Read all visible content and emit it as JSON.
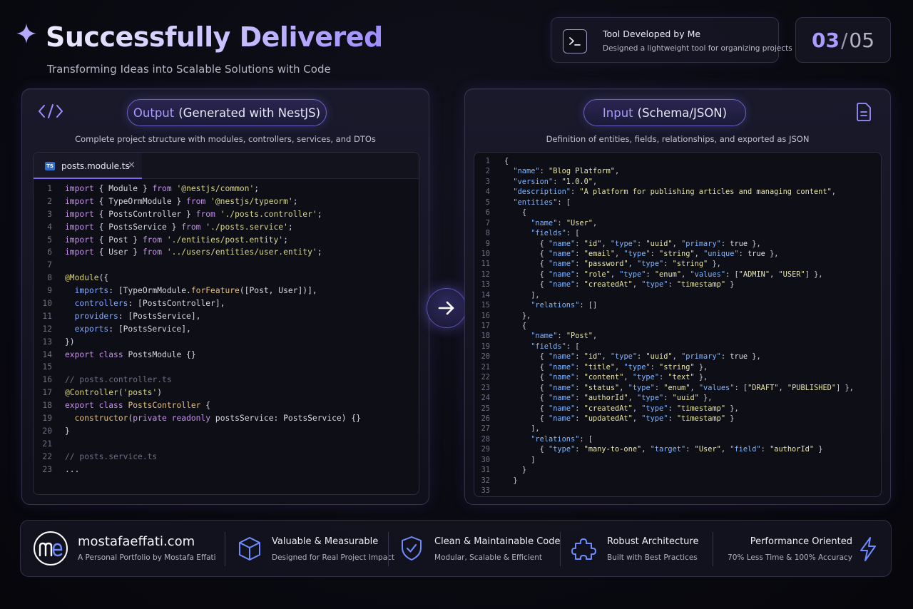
{
  "header": {
    "title": "Successfully Delivered",
    "subtitle": "Transforming Ideas into Scalable Solutions with Code"
  },
  "tool_card": {
    "title": "Tool Developed by Me",
    "description": "Designed a lightweight tool for organizing projects"
  },
  "counter": {
    "current": "03",
    "separator": "/",
    "total": "05"
  },
  "output_panel": {
    "pill_highlight": "Output",
    "pill_rest": "(Generated with NestJS)",
    "description": "Complete project structure with modules, controllers, services, and DTOs",
    "tab_label": "posts.module.ts",
    "file_badge": "TS",
    "close_glyph": "×",
    "code_lines": [
      [
        [
          "kw",
          "import"
        ],
        [
          "pl",
          " { Module } "
        ],
        [
          "kw",
          "from"
        ],
        [
          "pl",
          " "
        ],
        [
          "str",
          "'@nestjs/common'"
        ],
        [
          "pl",
          ";"
        ]
      ],
      [
        [
          "kw",
          "import"
        ],
        [
          "pl",
          " { TypeOrmModule } "
        ],
        [
          "kw",
          "from"
        ],
        [
          "pl",
          " "
        ],
        [
          "str",
          "'@nestjs/typeorm'"
        ],
        [
          "pl",
          ";"
        ]
      ],
      [
        [
          "kw",
          "import"
        ],
        [
          "pl",
          " { PostsController } "
        ],
        [
          "kw",
          "from"
        ],
        [
          "pl",
          " "
        ],
        [
          "str",
          "'./posts.controller'"
        ],
        [
          "pl",
          ";"
        ]
      ],
      [
        [
          "kw",
          "import"
        ],
        [
          "pl",
          " { PostsService } "
        ],
        [
          "kw",
          "from"
        ],
        [
          "pl",
          " "
        ],
        [
          "str",
          "'./posts.service'"
        ],
        [
          "pl",
          ";"
        ]
      ],
      [
        [
          "kw",
          "import"
        ],
        [
          "pl",
          " { Post } "
        ],
        [
          "kw",
          "from"
        ],
        [
          "pl",
          " "
        ],
        [
          "str",
          "'./entities/post.entity'"
        ],
        [
          "pl",
          ";"
        ]
      ],
      [
        [
          "kw",
          "import"
        ],
        [
          "pl",
          " { User } "
        ],
        [
          "kw",
          "from"
        ],
        [
          "pl",
          " "
        ],
        [
          "str",
          "'../users/entities/user.entity'"
        ],
        [
          "pl",
          ";"
        ]
      ],
      [],
      [
        [
          "dec",
          "@Module"
        ],
        [
          "pl",
          "({"
        ]
      ],
      [
        [
          "pl",
          "  "
        ],
        [
          "prop",
          "imports"
        ],
        [
          "pl",
          ": [TypeOrmModule."
        ],
        [
          "fn",
          "forFeature"
        ],
        [
          "pl",
          "([Post, User])],"
        ]
      ],
      [
        [
          "pl",
          "  "
        ],
        [
          "prop",
          "controllers"
        ],
        [
          "pl",
          ": [PostsController],"
        ]
      ],
      [
        [
          "pl",
          "  "
        ],
        [
          "prop",
          "providers"
        ],
        [
          "pl",
          ": [PostsService],"
        ]
      ],
      [
        [
          "pl",
          "  "
        ],
        [
          "prop",
          "exports"
        ],
        [
          "pl",
          ": [PostsService],"
        ]
      ],
      [
        [
          "pl",
          "})"
        ]
      ],
      [
        [
          "kw",
          "export"
        ],
        [
          "pl",
          " "
        ],
        [
          "kw",
          "class"
        ],
        [
          "pl",
          " PostsModule {}"
        ]
      ],
      [],
      [
        [
          "cmt",
          "// posts.controller.ts"
        ]
      ],
      [
        [
          "dec",
          "@Controller"
        ],
        [
          "pl",
          "("
        ],
        [
          "str",
          "'posts'"
        ],
        [
          "pl",
          ")"
        ]
      ],
      [
        [
          "kw",
          "export"
        ],
        [
          "pl",
          " "
        ],
        [
          "kw",
          "class"
        ],
        [
          "pl",
          " "
        ],
        [
          "fn",
          "PostsController"
        ],
        [
          "pl",
          " {"
        ]
      ],
      [
        [
          "pl",
          "  "
        ],
        [
          "fn",
          "constructor"
        ],
        [
          "pl",
          "("
        ],
        [
          "kw",
          "private"
        ],
        [
          "pl",
          " "
        ],
        [
          "kw",
          "readonly"
        ],
        [
          "pl",
          " postsService: PostsService) {}"
        ]
      ],
      [
        [
          "pl",
          "}"
        ]
      ],
      [],
      [
        [
          "cmt",
          "// posts.service.ts"
        ]
      ],
      [
        [
          "pl",
          "..."
        ]
      ]
    ]
  },
  "input_panel": {
    "pill_highlight": "Input",
    "pill_rest": "(Schema/JSON)",
    "description": "Definition of entities, fields, relationships, and exported as JSON",
    "code_lines": [
      [
        [
          "punc",
          "{"
        ]
      ],
      [
        [
          "pl",
          "  "
        ],
        [
          "key",
          "\"name\""
        ],
        [
          "punc",
          ": "
        ],
        [
          "jstr",
          "\"Blog Platform\""
        ],
        [
          "punc",
          ","
        ]
      ],
      [
        [
          "pl",
          "  "
        ],
        [
          "key",
          "\"version\""
        ],
        [
          "punc",
          ": "
        ],
        [
          "jstr",
          "\"1.0.0\""
        ],
        [
          "punc",
          ","
        ]
      ],
      [
        [
          "pl",
          "  "
        ],
        [
          "key",
          "\"description\""
        ],
        [
          "punc",
          ": "
        ],
        [
          "jstr",
          "\"A platform for publishing articles and managing content\""
        ],
        [
          "punc",
          ","
        ]
      ],
      [
        [
          "pl",
          "  "
        ],
        [
          "key",
          "\"entities\""
        ],
        [
          "punc",
          ": ["
        ]
      ],
      [
        [
          "pl",
          "    "
        ],
        [
          "punc",
          "{"
        ]
      ],
      [
        [
          "pl",
          "      "
        ],
        [
          "key",
          "\"name\""
        ],
        [
          "punc",
          ": "
        ],
        [
          "jstr",
          "\"User\""
        ],
        [
          "punc",
          ","
        ]
      ],
      [
        [
          "pl",
          "      "
        ],
        [
          "key",
          "\"fields\""
        ],
        [
          "punc",
          ": ["
        ]
      ],
      [
        [
          "pl",
          "        "
        ],
        [
          "punc",
          "{ "
        ],
        [
          "key",
          "\"name\""
        ],
        [
          "punc",
          ": "
        ],
        [
          "jstr",
          "\"id\""
        ],
        [
          "punc",
          ", "
        ],
        [
          "key",
          "\"type\""
        ],
        [
          "punc",
          ": "
        ],
        [
          "jstr",
          "\"uuid\""
        ],
        [
          "punc",
          ", "
        ],
        [
          "key",
          "\"primary\""
        ],
        [
          "punc",
          ": "
        ],
        [
          "jkw",
          "true"
        ],
        [
          "punc",
          " },"
        ]
      ],
      [
        [
          "pl",
          "        "
        ],
        [
          "punc",
          "{ "
        ],
        [
          "key",
          "\"name\""
        ],
        [
          "punc",
          ": "
        ],
        [
          "jstr",
          "\"email\""
        ],
        [
          "punc",
          ", "
        ],
        [
          "key",
          "\"type\""
        ],
        [
          "punc",
          ": "
        ],
        [
          "jstr",
          "\"string\""
        ],
        [
          "punc",
          ", "
        ],
        [
          "key",
          "\"unique\""
        ],
        [
          "punc",
          ": "
        ],
        [
          "jkw",
          "true"
        ],
        [
          "punc",
          " },"
        ]
      ],
      [
        [
          "pl",
          "        "
        ],
        [
          "punc",
          "{ "
        ],
        [
          "key",
          "\"name\""
        ],
        [
          "punc",
          ": "
        ],
        [
          "jstr",
          "\"password\""
        ],
        [
          "punc",
          ", "
        ],
        [
          "key",
          "\"type\""
        ],
        [
          "punc",
          ": "
        ],
        [
          "jstr",
          "\"string\""
        ],
        [
          "punc",
          " },"
        ]
      ],
      [
        [
          "pl",
          "        "
        ],
        [
          "punc",
          "{ "
        ],
        [
          "key",
          "\"name\""
        ],
        [
          "punc",
          ": "
        ],
        [
          "jstr",
          "\"role\""
        ],
        [
          "punc",
          ", "
        ],
        [
          "key",
          "\"type\""
        ],
        [
          "punc",
          ": "
        ],
        [
          "jstr",
          "\"enum\""
        ],
        [
          "punc",
          ", "
        ],
        [
          "key",
          "\"values\""
        ],
        [
          "punc",
          ": ["
        ],
        [
          "jstr",
          "\"ADMIN\""
        ],
        [
          "punc",
          ", "
        ],
        [
          "jstr",
          "\"USER\""
        ],
        [
          "punc",
          "] },"
        ]
      ],
      [
        [
          "pl",
          "        "
        ],
        [
          "punc",
          "{ "
        ],
        [
          "key",
          "\"name\""
        ],
        [
          "punc",
          ": "
        ],
        [
          "jstr",
          "\"createdAt\""
        ],
        [
          "punc",
          ", "
        ],
        [
          "key",
          "\"type\""
        ],
        [
          "punc",
          ": "
        ],
        [
          "jstr",
          "\"timestamp\""
        ],
        [
          "punc",
          " }"
        ]
      ],
      [
        [
          "pl",
          "      "
        ],
        [
          "punc",
          "],"
        ]
      ],
      [
        [
          "pl",
          "      "
        ],
        [
          "key",
          "\"relations\""
        ],
        [
          "punc",
          ": []"
        ]
      ],
      [
        [
          "pl",
          "    "
        ],
        [
          "punc",
          "},"
        ]
      ],
      [
        [
          "pl",
          "    "
        ],
        [
          "punc",
          "{"
        ]
      ],
      [
        [
          "pl",
          "      "
        ],
        [
          "key",
          "\"name\""
        ],
        [
          "punc",
          ": "
        ],
        [
          "jstr",
          "\"Post\""
        ],
        [
          "punc",
          ","
        ]
      ],
      [
        [
          "pl",
          "      "
        ],
        [
          "key",
          "\"fields\""
        ],
        [
          "punc",
          ": ["
        ]
      ],
      [
        [
          "pl",
          "        "
        ],
        [
          "punc",
          "{ "
        ],
        [
          "key",
          "\"name\""
        ],
        [
          "punc",
          ": "
        ],
        [
          "jstr",
          "\"id\""
        ],
        [
          "punc",
          ", "
        ],
        [
          "key",
          "\"type\""
        ],
        [
          "punc",
          ": "
        ],
        [
          "jstr",
          "\"uuid\""
        ],
        [
          "punc",
          ", "
        ],
        [
          "key",
          "\"primary\""
        ],
        [
          "punc",
          ": "
        ],
        [
          "jkw",
          "true"
        ],
        [
          "punc",
          " },"
        ]
      ],
      [
        [
          "pl",
          "        "
        ],
        [
          "punc",
          "{ "
        ],
        [
          "key",
          "\"name\""
        ],
        [
          "punc",
          ": "
        ],
        [
          "jstr",
          "\"title\""
        ],
        [
          "punc",
          ", "
        ],
        [
          "key",
          "\"type\""
        ],
        [
          "punc",
          ": "
        ],
        [
          "jstr",
          "\"string\""
        ],
        [
          "punc",
          " },"
        ]
      ],
      [
        [
          "pl",
          "        "
        ],
        [
          "punc",
          "{ "
        ],
        [
          "key",
          "\"name\""
        ],
        [
          "punc",
          ": "
        ],
        [
          "jstr",
          "\"content\""
        ],
        [
          "punc",
          ", "
        ],
        [
          "key",
          "\"type\""
        ],
        [
          "punc",
          ": "
        ],
        [
          "jstr",
          "\"text\""
        ],
        [
          "punc",
          " },"
        ]
      ],
      [
        [
          "pl",
          "        "
        ],
        [
          "punc",
          "{ "
        ],
        [
          "key",
          "\"name\""
        ],
        [
          "punc",
          ": "
        ],
        [
          "jstr",
          "\"status\""
        ],
        [
          "punc",
          ", "
        ],
        [
          "key",
          "\"type\""
        ],
        [
          "punc",
          ": "
        ],
        [
          "jstr",
          "\"enum\""
        ],
        [
          "punc",
          ", "
        ],
        [
          "key",
          "\"values\""
        ],
        [
          "punc",
          ": ["
        ],
        [
          "jstr",
          "\"DRAFT\""
        ],
        [
          "punc",
          ", "
        ],
        [
          "jstr",
          "\"PUBLISHED\""
        ],
        [
          "punc",
          "] },"
        ]
      ],
      [
        [
          "pl",
          "        "
        ],
        [
          "punc",
          "{ "
        ],
        [
          "key",
          "\"name\""
        ],
        [
          "punc",
          ": "
        ],
        [
          "jstr",
          "\"authorId\""
        ],
        [
          "punc",
          ", "
        ],
        [
          "key",
          "\"type\""
        ],
        [
          "punc",
          ": "
        ],
        [
          "jstr",
          "\"uuid\""
        ],
        [
          "punc",
          " },"
        ]
      ],
      [
        [
          "pl",
          "        "
        ],
        [
          "punc",
          "{ "
        ],
        [
          "key",
          "\"name\""
        ],
        [
          "punc",
          ": "
        ],
        [
          "jstr",
          "\"createdAt\""
        ],
        [
          "punc",
          ", "
        ],
        [
          "key",
          "\"type\""
        ],
        [
          "punc",
          ": "
        ],
        [
          "jstr",
          "\"timestamp\""
        ],
        [
          "punc",
          " },"
        ]
      ],
      [
        [
          "pl",
          "        "
        ],
        [
          "punc",
          "{ "
        ],
        [
          "key",
          "\"name\""
        ],
        [
          "punc",
          ": "
        ],
        [
          "jstr",
          "\"updatedAt\""
        ],
        [
          "punc",
          ", "
        ],
        [
          "key",
          "\"type\""
        ],
        [
          "punc",
          ": "
        ],
        [
          "jstr",
          "\"timestamp\""
        ],
        [
          "punc",
          " }"
        ]
      ],
      [
        [
          "pl",
          "      "
        ],
        [
          "punc",
          "],"
        ]
      ],
      [
        [
          "pl",
          "      "
        ],
        [
          "key",
          "\"relations\""
        ],
        [
          "punc",
          ": ["
        ]
      ],
      [
        [
          "pl",
          "        "
        ],
        [
          "punc",
          "{ "
        ],
        [
          "key",
          "\"type\""
        ],
        [
          "punc",
          ": "
        ],
        [
          "jstr",
          "\"many-to-one\""
        ],
        [
          "punc",
          ", "
        ],
        [
          "key",
          "\"target\""
        ],
        [
          "punc",
          ": "
        ],
        [
          "jstr",
          "\"User\""
        ],
        [
          "punc",
          ", "
        ],
        [
          "key",
          "\"field\""
        ],
        [
          "punc",
          ": "
        ],
        [
          "jstr",
          "\"authorId\""
        ],
        [
          "punc",
          " }"
        ]
      ],
      [
        [
          "pl",
          "      "
        ],
        [
          "punc",
          "]"
        ]
      ],
      [
        [
          "pl",
          "    "
        ],
        [
          "punc",
          "}"
        ]
      ],
      [
        [
          "pl",
          "  "
        ],
        [
          "punc",
          "}"
        ]
      ],
      []
    ]
  },
  "footer": {
    "brand_site": "mostafaeffati.com",
    "brand_tagline": "A Personal Portfolio by Mostafa Effati",
    "features": [
      {
        "title": "Valuable & Measurable",
        "desc": "Designed for Real Project Impact",
        "icon": "cube-icon"
      },
      {
        "title": "Clean & Maintainable Code",
        "desc": "Modular, Scalable & Efficient",
        "icon": "shield-check-icon"
      },
      {
        "title": "Robust Architecture",
        "desc": "Built with Best Practices",
        "icon": "puzzle-icon"
      },
      {
        "title": "Performance Oriented",
        "desc": "70% Less Time & 100% Accuracy",
        "icon": "lightning-icon"
      }
    ]
  },
  "colors": {
    "accent": "#a99bff",
    "background": "#0a0a12",
    "panel_border": "#33334e",
    "footer_icon": "#6f8cff"
  }
}
